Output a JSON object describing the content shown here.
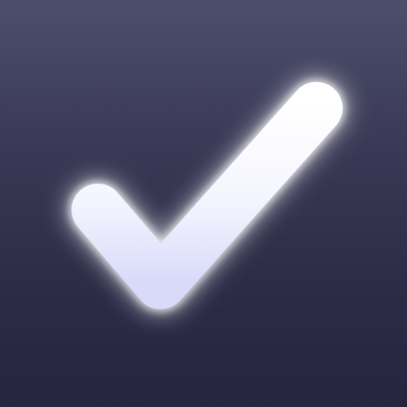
{
  "icon": {
    "name": "checkmark-icon",
    "background_colors": [
      "#4d4e6b",
      "#3a3a56",
      "#2c2c47",
      "#252540"
    ],
    "glyph_colors": [
      "#ffffff",
      "#f4f4ff",
      "#d9dafa"
    ],
    "glow_color": "#ffffff"
  }
}
